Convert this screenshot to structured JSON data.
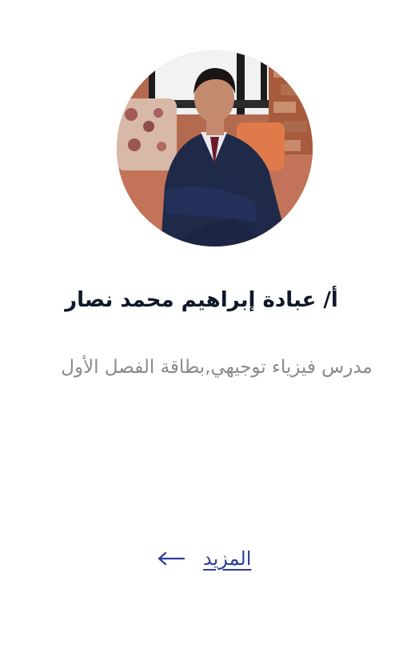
{
  "teacher": {
    "photo_icon": "profile-photo",
    "name": "أ/ عبادة إبراهيم محمد نصار",
    "description": "مدرس فيزياء توجيهي,بطاقة الفصل الأول"
  },
  "actions": {
    "more_label": "المزيد",
    "more_icon": "arrow-left-icon",
    "link_color": "#2c3e9c"
  },
  "colors": {
    "name_text": "#0f172a",
    "description_text": "#8a8a8a",
    "background": "#ffffff"
  }
}
